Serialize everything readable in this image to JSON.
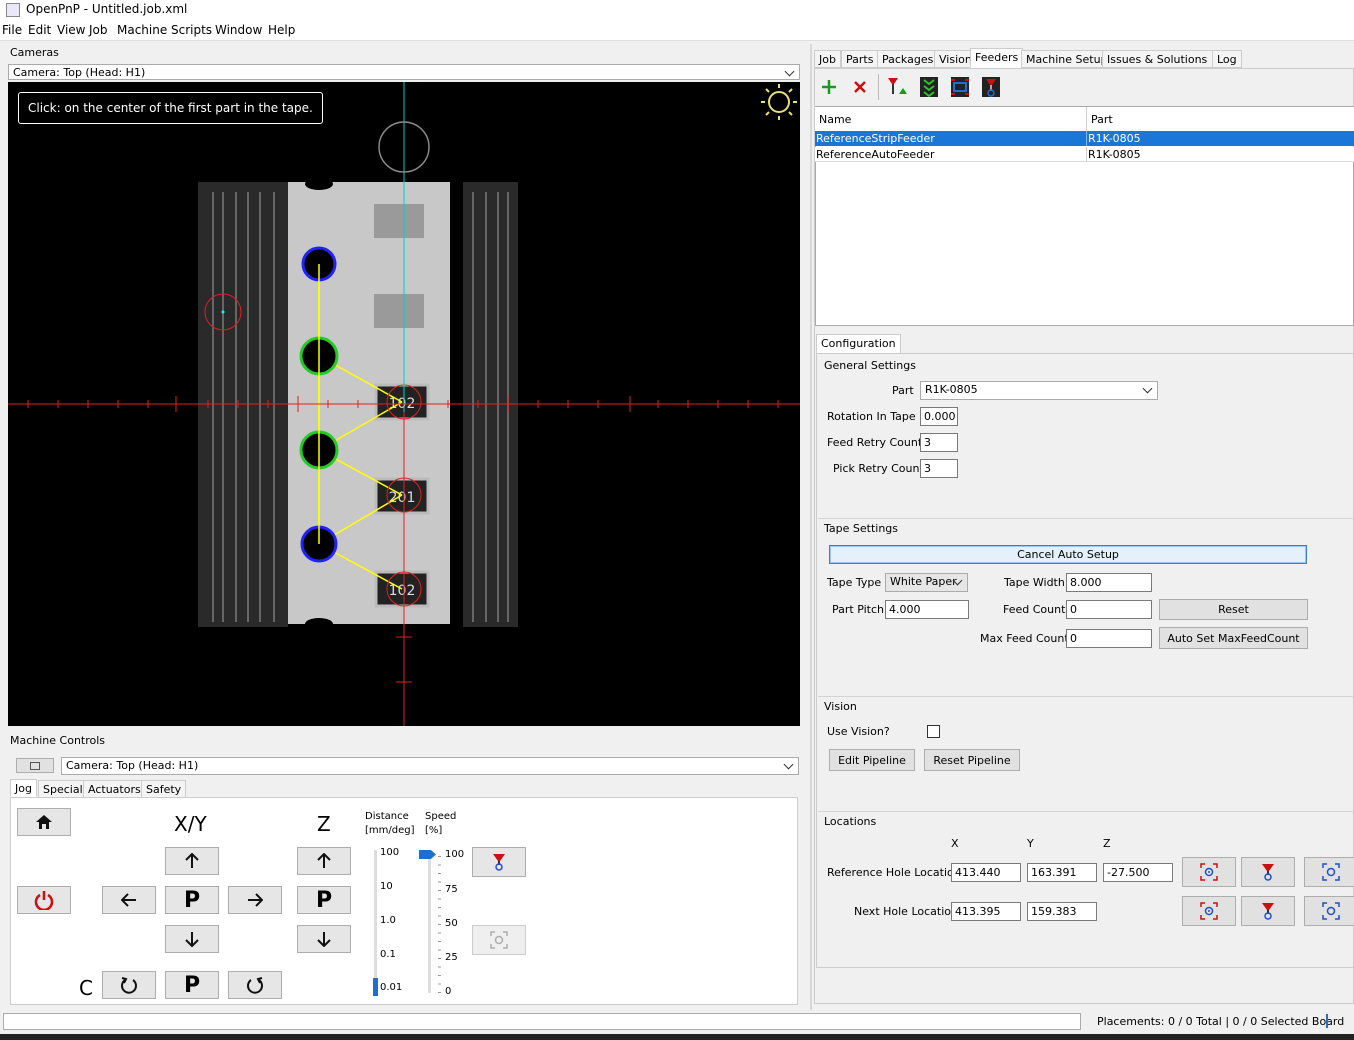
{
  "window": {
    "title": "OpenPnP - Untitled.job.xml"
  },
  "menu": [
    "File",
    "Edit",
    "View",
    "Job",
    "Machine",
    "Scripts",
    "Window",
    "Help"
  ],
  "cameras": {
    "section_label": "Cameras",
    "camera_select": "Camera: Top (Head: H1)",
    "instruction": "Click: on the center of the first part in the tape."
  },
  "machine_controls": {
    "section_label": "Machine Controls",
    "camera_select": "Camera: Top (Head: H1)",
    "tabs": [
      "Jog",
      "Special",
      "Actuators",
      "Safety"
    ],
    "xy_label": "X/Y",
    "z_label": "Z",
    "c_label": "C",
    "park_label": "P",
    "distance_label": "Distance",
    "distance_unit": "[mm/deg]",
    "speed_label": "Speed",
    "speed_unit": "[%]",
    "distance_ticks": [
      "100",
      "10",
      "1.0",
      "0.1",
      "0.01"
    ],
    "speed_ticks": [
      "100",
      "75",
      "50",
      "25",
      "0"
    ],
    "distance_selected": "0.01",
    "speed_value": 100
  },
  "right_tabs": [
    "Job",
    "Parts",
    "Packages",
    "Vision",
    "Feeders",
    "Machine Setup",
    "Issues & Solutions",
    "Log"
  ],
  "active_right_tab": "Feeders",
  "feeder_table": {
    "columns": [
      "Name",
      "Part"
    ],
    "rows": [
      {
        "name": "ReferenceStripFeeder",
        "part": "R1K-0805",
        "selected": true
      },
      {
        "name": "ReferenceAutoFeeder",
        "part": "R1K-0805",
        "selected": false
      }
    ]
  },
  "configuration": {
    "tab": "Configuration",
    "general": {
      "title": "General Settings",
      "part_label": "Part",
      "part_value": "R1K-0805",
      "rotation_label": "Rotation In Tape",
      "rotation_value": "0.000",
      "feed_retry_label": "Feed Retry Count",
      "feed_retry_value": "3",
      "pick_retry_label": "Pick Retry Count",
      "pick_retry_value": "3"
    },
    "tape": {
      "title": "Tape Settings",
      "cancel_button": "Cancel Auto Setup",
      "tape_type_label": "Tape Type",
      "tape_type_value": "White Paper",
      "tape_width_label": "Tape Width",
      "tape_width_value": "8.000",
      "part_pitch_label": "Part Pitch",
      "part_pitch_value": "4.000",
      "feed_count_label": "Feed Count",
      "feed_count_value": "0",
      "reset_button": "Reset",
      "max_feed_label": "Max Feed Count",
      "max_feed_value": "0",
      "auto_set_button": "Auto Set MaxFeedCount"
    },
    "vision": {
      "title": "Vision",
      "use_vision_label": "Use Vision?",
      "edit_pipeline": "Edit Pipeline",
      "reset_pipeline": "Reset Pipeline"
    },
    "locations": {
      "title": "Locations",
      "col_x": "X",
      "col_y": "Y",
      "col_z": "Z",
      "ref_label": "Reference Hole Location",
      "ref_x": "413.440",
      "ref_y": "163.391",
      "ref_z": "-27.500",
      "next_label": "Next Hole Location",
      "next_x": "413.395",
      "next_y": "159.383"
    }
  },
  "status": {
    "placements": "Placements: 0 / 0 Total | 0 / 0 Selected Board"
  },
  "camera_marks": [
    "102",
    "201",
    "102"
  ]
}
